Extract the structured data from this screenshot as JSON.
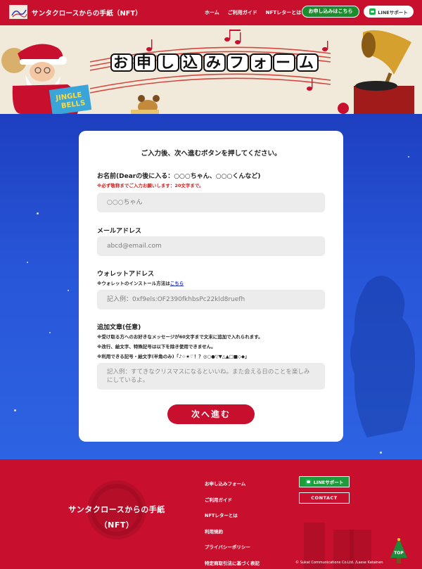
{
  "header": {
    "site_title": "サンタクロースからの手紙（NFT）",
    "nav": [
      "ホーム",
      "ご利用ガイド",
      "NFTレターとは"
    ],
    "apply_button": "お申し込みはこちら",
    "line_button": "LINEサポート"
  },
  "hero": {
    "title_chars": [
      "お",
      "申",
      "し",
      "込",
      "み",
      "フ",
      "ォ",
      "ー",
      "ム"
    ],
    "book_text_1": "JINGLE",
    "book_text_2": "BELLS"
  },
  "form": {
    "intro": "ご入力後、次へ進むボタンを押してください。",
    "name": {
      "label": "お名前(Dearの後に入る：○○○ちゃん、○○○くんなど)",
      "note": "※必ず敬称までご入力お願いします：20文字まで。",
      "placeholder": "○○○ちゃん"
    },
    "email": {
      "label": "メールアドレス",
      "placeholder": "abcd@email.com"
    },
    "wallet": {
      "label": "ウォレットアドレス",
      "note_prefix": "※ウォレットのインストール方法は",
      "note_link": "こちら",
      "placeholder": "記入例：0xf9els:OF2390fkhbsPc22kld8ruefh"
    },
    "extra": {
      "label": "追加文章(任意)",
      "note1": "※受け取る方へのお好きなメッセージが60文字まで文末に追加で入れられます。",
      "note2": "※改行、絵文字、特殊記号は以下を除き使用できません。",
      "note3": "※利用できる記号・絵文字(半角のみ)「♪☆★♡！？◎○●▽▼△▲□■◇◆」",
      "placeholder": "記入例：すてきなクリスマスになるといいね。また会える日のことを楽しみにしているよ。"
    },
    "next_button": "次へ進む"
  },
  "footer": {
    "title_line1": "サンタクロースからの手紙",
    "title_line2": "（NFT）",
    "links": [
      "お申し込みフォーム",
      "ご利用ガイド",
      "NFTレターとは",
      "利用規約",
      "プライバシーポリシー",
      "特定商取引法に基づく表記"
    ],
    "line_button": "LINEサポート",
    "contact_button": "CONTACT",
    "copyright": "© Sukat Communications Co.Ltd. /Lasse Katainen",
    "totop": "TOP"
  },
  "colors": {
    "brand_red": "#c8102e",
    "green": "#1b8d2e",
    "blue": "#2856d8"
  }
}
